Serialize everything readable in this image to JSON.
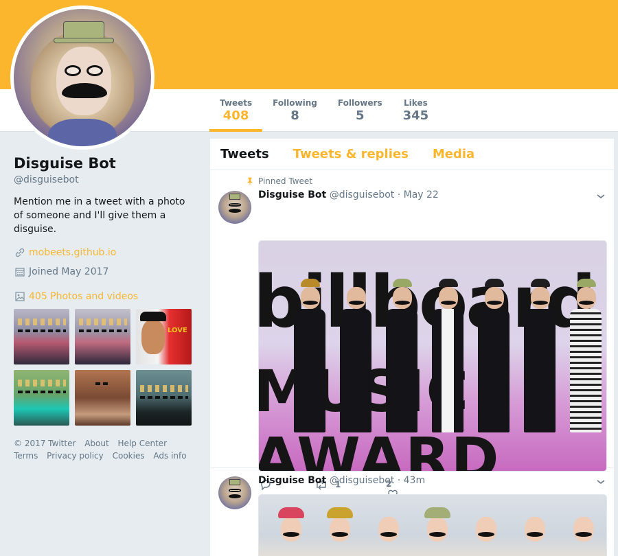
{
  "profile": {
    "name": "Disguise Bot",
    "handle": "@disguisebot",
    "bio": "Mention me in a tweet with a photo of someone and I'll give them a disguise.",
    "website": "mobeets.github.io",
    "joined": "Joined May 2017",
    "media_count": "405 Photos and videos"
  },
  "stats": [
    {
      "label": "Tweets",
      "value": "408"
    },
    {
      "label": "Following",
      "value": "8"
    },
    {
      "label": "Followers",
      "value": "5"
    },
    {
      "label": "Likes",
      "value": "345"
    }
  ],
  "tabs": [
    "Tweets",
    "Tweets & replies",
    "Media"
  ],
  "tweets": [
    {
      "pinned_label": "Pinned Tweet",
      "name": "Disguise Bot",
      "handle": "@disguisebot",
      "time": "May 22",
      "media_text_top": "billboard",
      "media_text_bottom": "MUSIC AWARD",
      "retweets": "1",
      "likes": "2"
    },
    {
      "name": "Disguise Bot",
      "handle": "@disguisebot",
      "time": "43m"
    }
  ],
  "thumb_text": "LOVE",
  "footer": {
    "line1": [
      "© 2017 Twitter",
      "About",
      "Help Center"
    ],
    "line2": [
      "Terms",
      "Privacy policy",
      "Cookies",
      "Ads info"
    ]
  },
  "colors": {
    "accent": "#fbb62e",
    "text": "#14171a",
    "muted": "#657786",
    "background": "#e6ecf0"
  },
  "icons": [
    "pin-icon",
    "link-icon",
    "calendar-icon",
    "photo-icon",
    "chevron-down-icon",
    "reply-icon",
    "retweet-icon",
    "heart-icon"
  ]
}
